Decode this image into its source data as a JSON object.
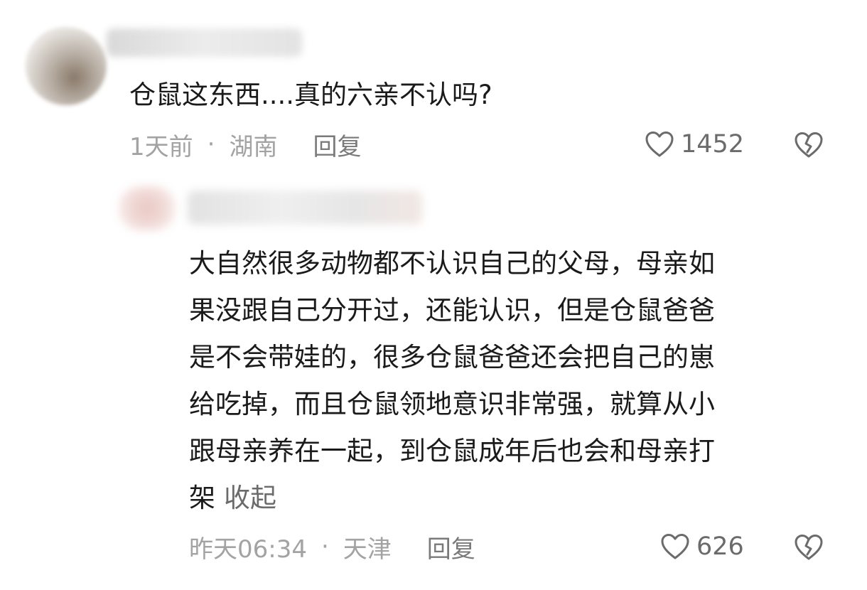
{
  "comments": [
    {
      "text": "仓鼠这东西....真的六亲不认吗?",
      "time": "1天前",
      "separator": "·",
      "location": "湖南",
      "reply_label": "回复",
      "like_count": "1452"
    },
    {
      "text_lines": [
        "大自然很多动物都不认识自己的父母，母亲如",
        "果没跟自己分开过，还能认识，但是仓鼠爸爸",
        "是不会带娃的，很多仓鼠爸爸还会把自己的崽",
        "给吃掉，而且仓鼠领地意识非常强，就算从小",
        "跟母亲养在一起，到仓鼠成年后也会和母亲打",
        "架"
      ],
      "collapse_label": "收起",
      "time": "昨天06:34",
      "separator": "·",
      "location": "天津",
      "reply_label": "回复",
      "like_count": "626"
    }
  ],
  "icons": {
    "like": "heart-outline-icon",
    "dislike": "broken-heart-icon"
  },
  "colors": {
    "text": "#1a1a1a",
    "meta": "#a3a3a3",
    "reply": "#7a7a7a",
    "icon": "#6b6b6b"
  }
}
